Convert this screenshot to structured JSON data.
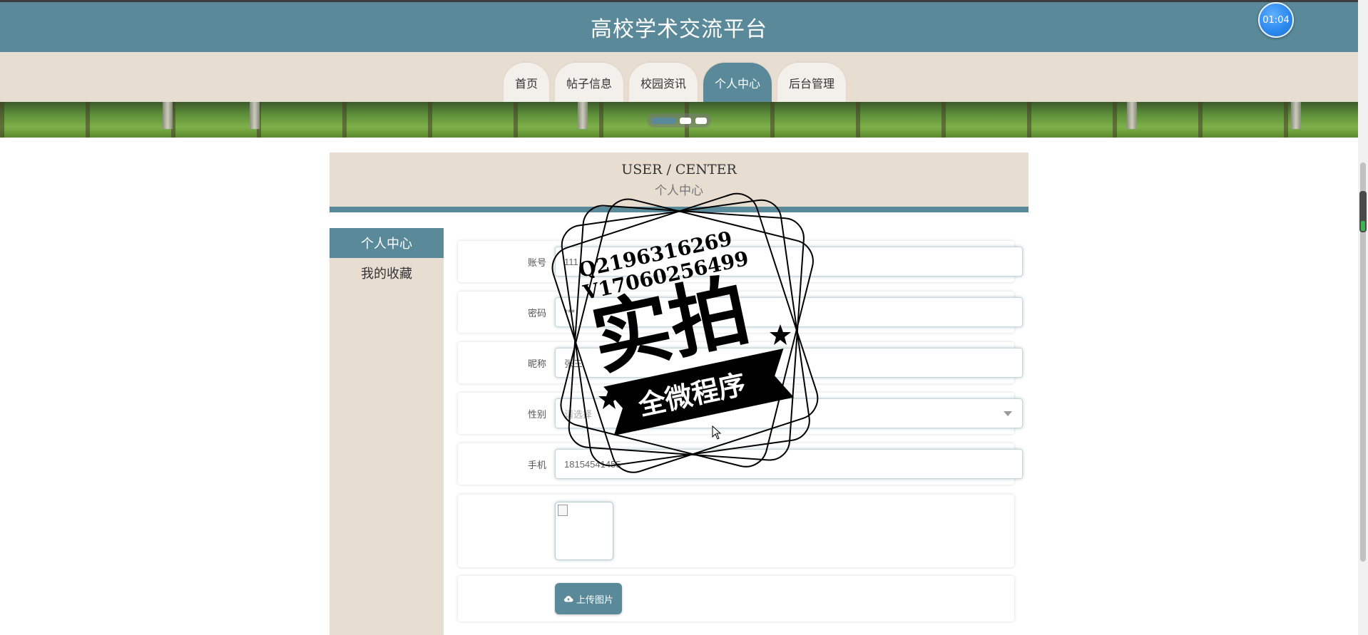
{
  "header": {
    "title": "高校学术交流平台",
    "timer": "01:04"
  },
  "nav": {
    "tabs": [
      {
        "label": "首页",
        "active": false
      },
      {
        "label": "帖子信息",
        "active": false
      },
      {
        "label": "校园资讯",
        "active": false
      },
      {
        "label": "个人中心",
        "active": true
      },
      {
        "label": "后台管理",
        "active": false
      }
    ]
  },
  "section": {
    "title_en": "USER / CENTER",
    "title_cn": "个人中心"
  },
  "sidebar": {
    "items": [
      {
        "label": "个人中心",
        "active": true
      },
      {
        "label": "我的收藏",
        "active": false
      }
    ]
  },
  "form": {
    "account": {
      "label": "账号",
      "value": "111"
    },
    "password": {
      "label": "密码",
      "value": "***"
    },
    "nickname": {
      "label": "昵称",
      "value": "张三"
    },
    "gender": {
      "label": "性别",
      "placeholder": "请选择"
    },
    "phone": {
      "label": "手机",
      "value": "18154541455"
    },
    "upload_label": "上传图片"
  },
  "watermark": {
    "contact1": "Q2196316269",
    "contact2": "V17060256499",
    "big": "实拍",
    "ribbon": "全微程序"
  },
  "colors": {
    "accent": "#5a8a99",
    "beige": "#e8ddd1"
  }
}
